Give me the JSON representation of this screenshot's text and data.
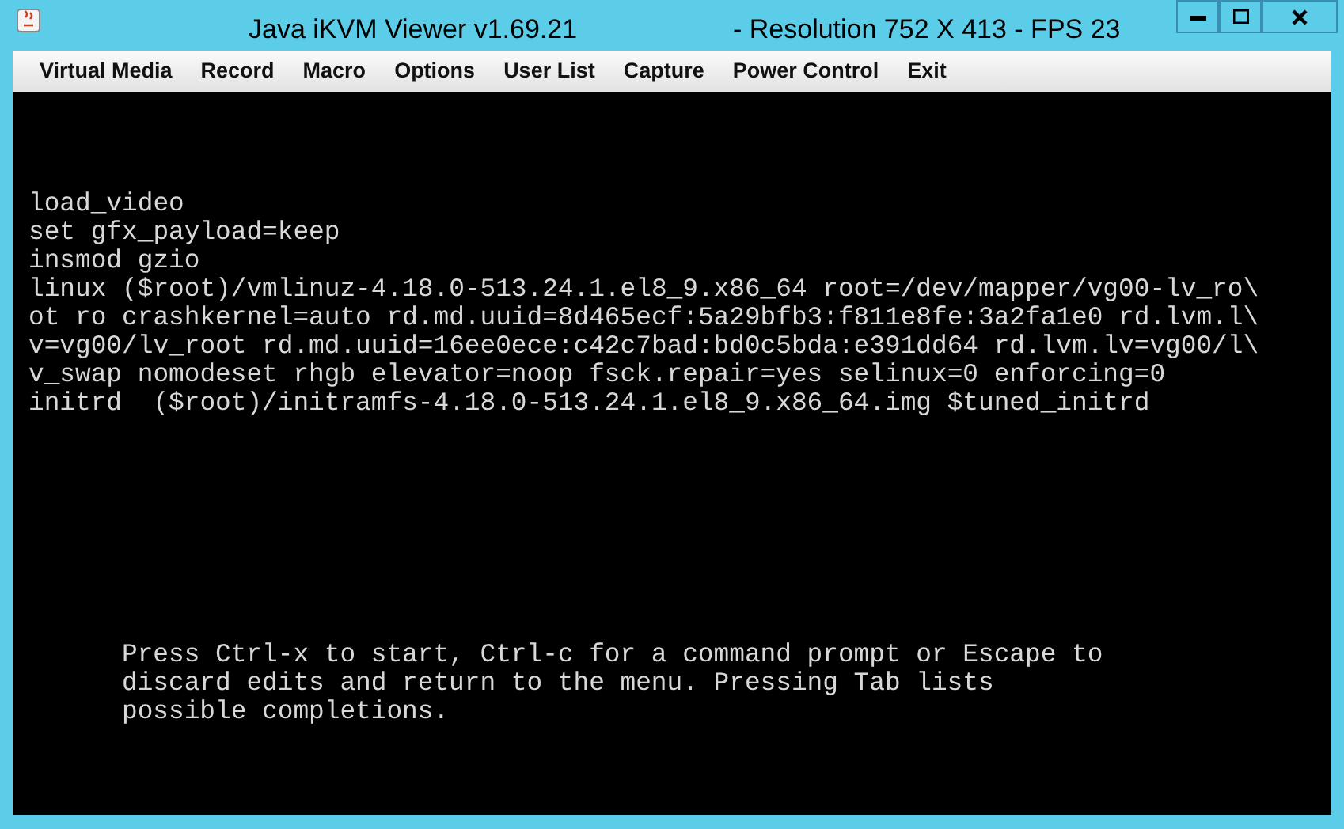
{
  "window": {
    "title": "Java iKVM Viewer v1.69.21",
    "subtitle": "- Resolution 752 X 413 - FPS 23"
  },
  "menu": [
    "Virtual Media",
    "Record",
    "Macro",
    "Options",
    "User List",
    "Capture",
    "Power Control",
    "Exit"
  ],
  "console": {
    "lines": [
      "load_video",
      "set gfx_payload=keep",
      "insmod gzio",
      "linux ($root)/vmlinuz-4.18.0-513.24.1.el8_9.x86_64 root=/dev/mapper/vg00-lv_ro\\",
      "ot ro crashkernel=auto rd.md.uuid=8d465ecf:5a29bfb3:f811e8fe:3a2fa1e0 rd.lvm.l\\",
      "v=vg00/lv_root rd.md.uuid=16ee0ece:c42c7bad:bd0c5bda:e391dd64 rd.lvm.lv=vg00/l\\",
      "v_swap nomodeset rhgb elevator=noop fsck.repair=yes selinux=0 enforcing=0",
      "initrd  ($root)/initramfs-4.18.0-513.24.1.el8_9.x86_64.img $tuned_initrd"
    ],
    "help": [
      "Press Ctrl-x to start, Ctrl-c for a command prompt or Escape to",
      "discard edits and return to the menu. Pressing Tab lists",
      "possible completions."
    ]
  }
}
